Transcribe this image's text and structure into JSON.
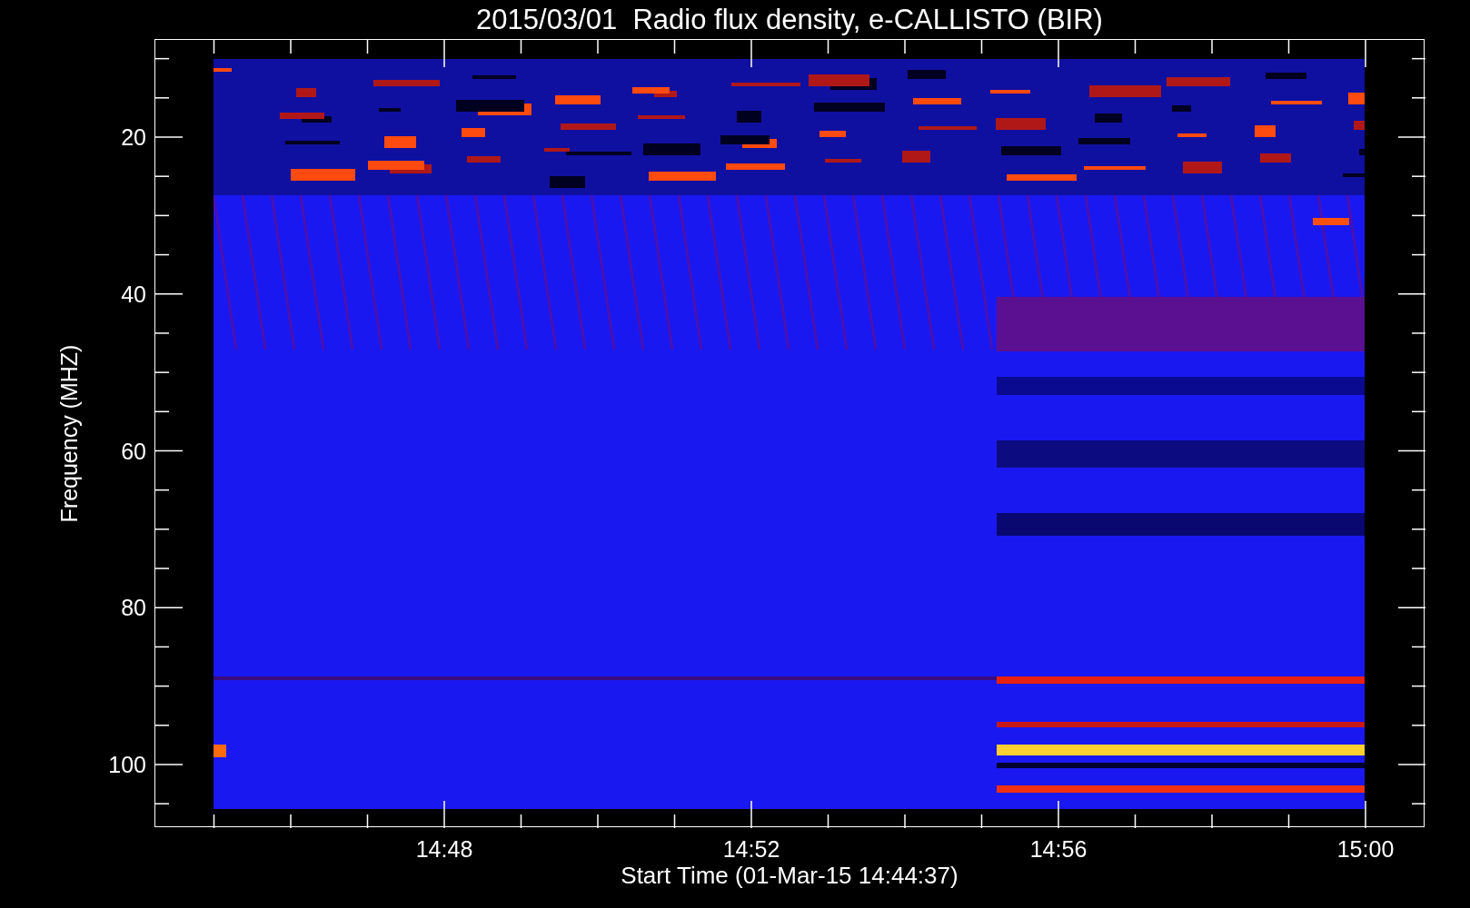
{
  "title": "2015/03/01  Radio flux density, e-CALLISTO (BIR)",
  "y_axis": {
    "label": "Frequency (MHZ)",
    "ticks": [
      "20",
      "40",
      "60",
      "80",
      "100"
    ]
  },
  "x_axis": {
    "label": "Start Time (01-Mar-15 14:44:37)",
    "ticks": [
      "14:48",
      "14:52",
      "14:56",
      "15:00"
    ]
  }
}
